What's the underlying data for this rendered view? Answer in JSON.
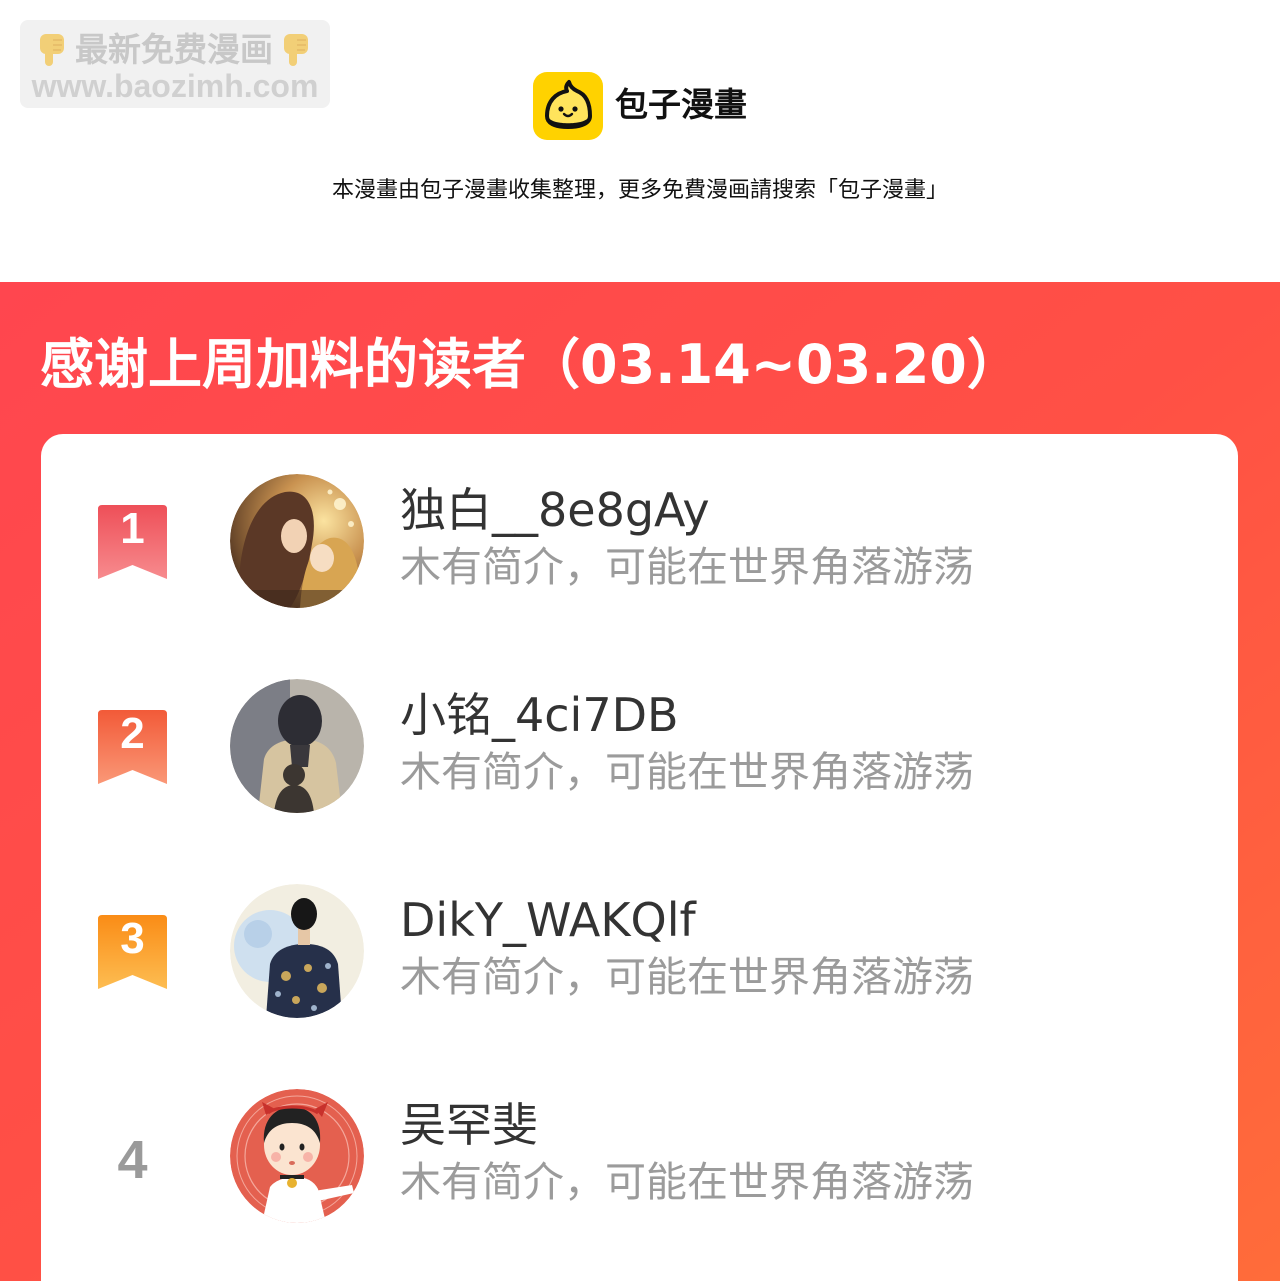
{
  "watermark": {
    "icon": "pointing-down-icon",
    "text": "最新免费漫画",
    "url": "www.baozimh.com"
  },
  "brand": {
    "logo_icon": "steamed-bun-icon",
    "logo_color": "#ffd200",
    "name": "包子漫畫"
  },
  "notice": "本漫畫由包子漫畫收集整理，更多免費漫画請搜索「包子漫畫」",
  "banner": {
    "title": "感谢上周加料的读者（03.14~03.20）",
    "colors": {
      "start": "#ff464f",
      "mid": "#ff5045",
      "end": "#ff6c3a"
    }
  },
  "readers": [
    {
      "rank": "1",
      "badge_colors": [
        "#ee4f58",
        "#f78b8e"
      ],
      "name": "独白__8e8gAy",
      "bio": "木有简介，可能在世界角落游荡"
    },
    {
      "rank": "2",
      "badge_colors": [
        "#f25a38",
        "#fa9877"
      ],
      "name": "小铭_4ci7DB",
      "bio": "木有简介，可能在世界角落游荡"
    },
    {
      "rank": "3",
      "badge_colors": [
        "#fa8c16",
        "#fdbd52"
      ],
      "name": "DikY_WAKQlf",
      "bio": "木有简介，可能在世界角落游荡"
    },
    {
      "rank": "4",
      "name": "吴罕斐",
      "bio": "木有简介，可能在世界角落游荡"
    }
  ]
}
